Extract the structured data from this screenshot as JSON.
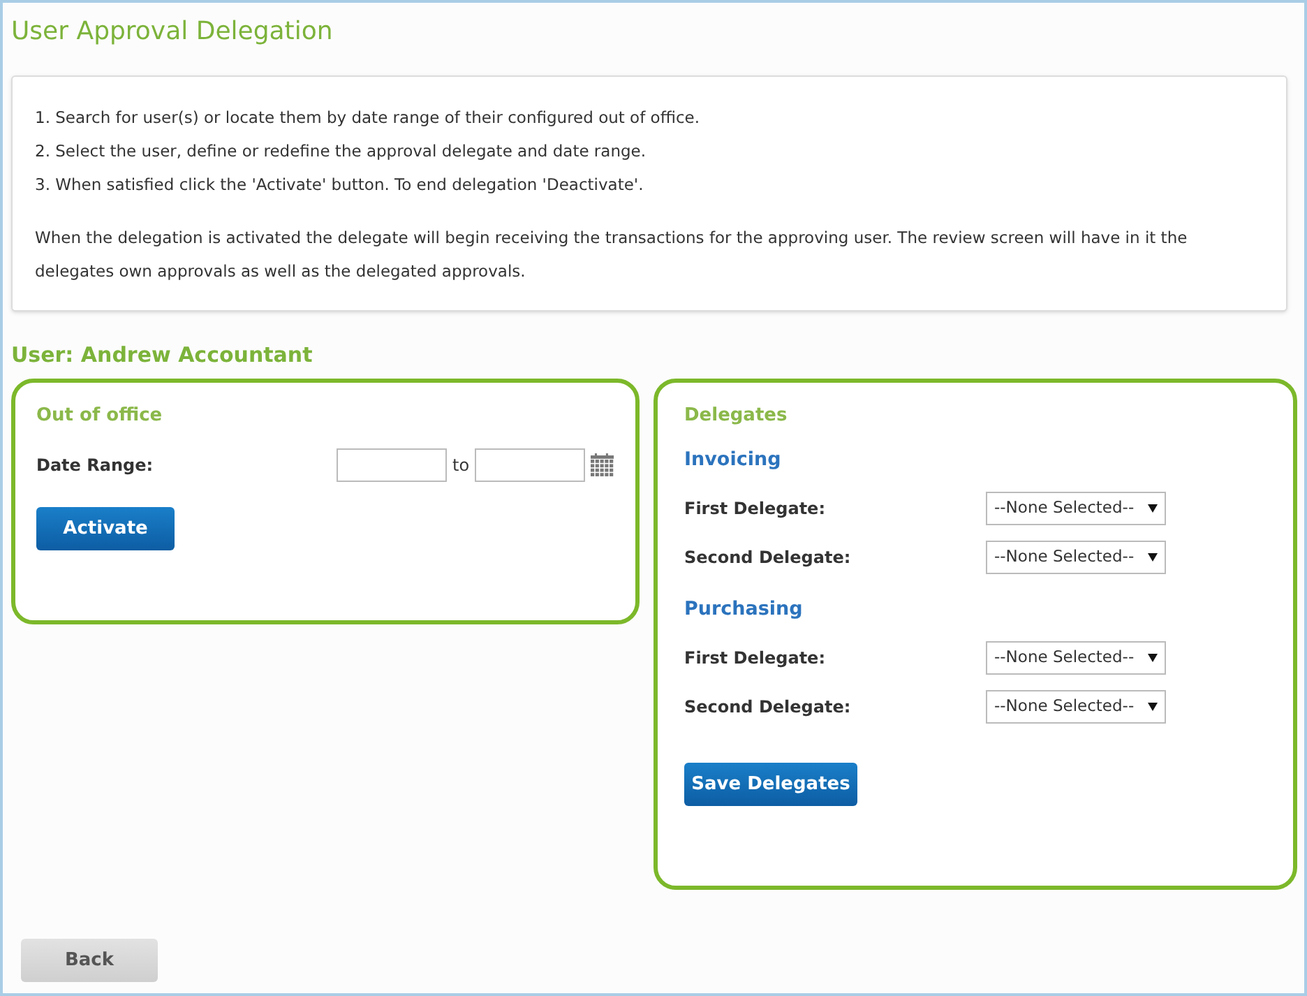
{
  "title": "User Approval Delegation",
  "instructions": {
    "steps": [
      "1. Search for user(s) or locate them by date range of their configured out of office.",
      "2. Select the user, define or redefine the approval delegate and date range.",
      "3. When satisfied click the 'Activate' button. To end delegation 'Deactivate'."
    ],
    "note": "When the delegation is activated the delegate will begin receiving the transactions for the approving user. The review screen will have in it the delegates own approvals as well as the delegated approvals."
  },
  "user_heading": "User: Andrew Accountant",
  "out_of_office": {
    "title": "Out of office",
    "date_label": "Date Range:",
    "to_label": "to",
    "button": "Activate"
  },
  "delegates": {
    "title": "Delegates",
    "sections": [
      {
        "title": "Invoicing",
        "rows": [
          {
            "label": "First Delegate:",
            "value": "--None Selected--"
          },
          {
            "label": "Second Delegate:",
            "value": "--None Selected--"
          }
        ]
      },
      {
        "title": "Purchasing",
        "rows": [
          {
            "label": "First Delegate:",
            "value": "--None Selected--"
          },
          {
            "label": "Second Delegate:",
            "value": "--None Selected--"
          }
        ]
      }
    ],
    "button": "Save Delegates"
  },
  "back_button": "Back"
}
